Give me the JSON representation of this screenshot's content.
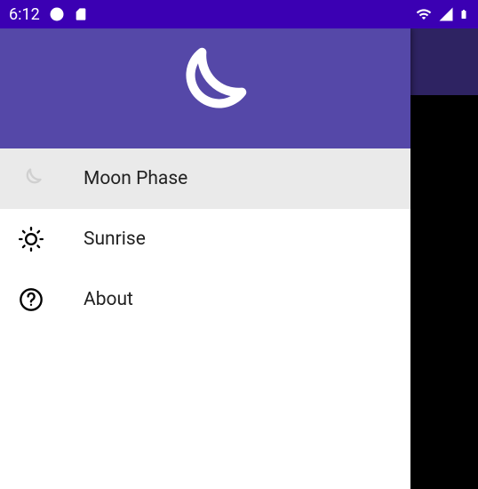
{
  "status": {
    "time": "6:12"
  },
  "nav": {
    "items": [
      {
        "label": "Moon Phase"
      },
      {
        "label": "Sunrise"
      },
      {
        "label": "About"
      }
    ]
  }
}
